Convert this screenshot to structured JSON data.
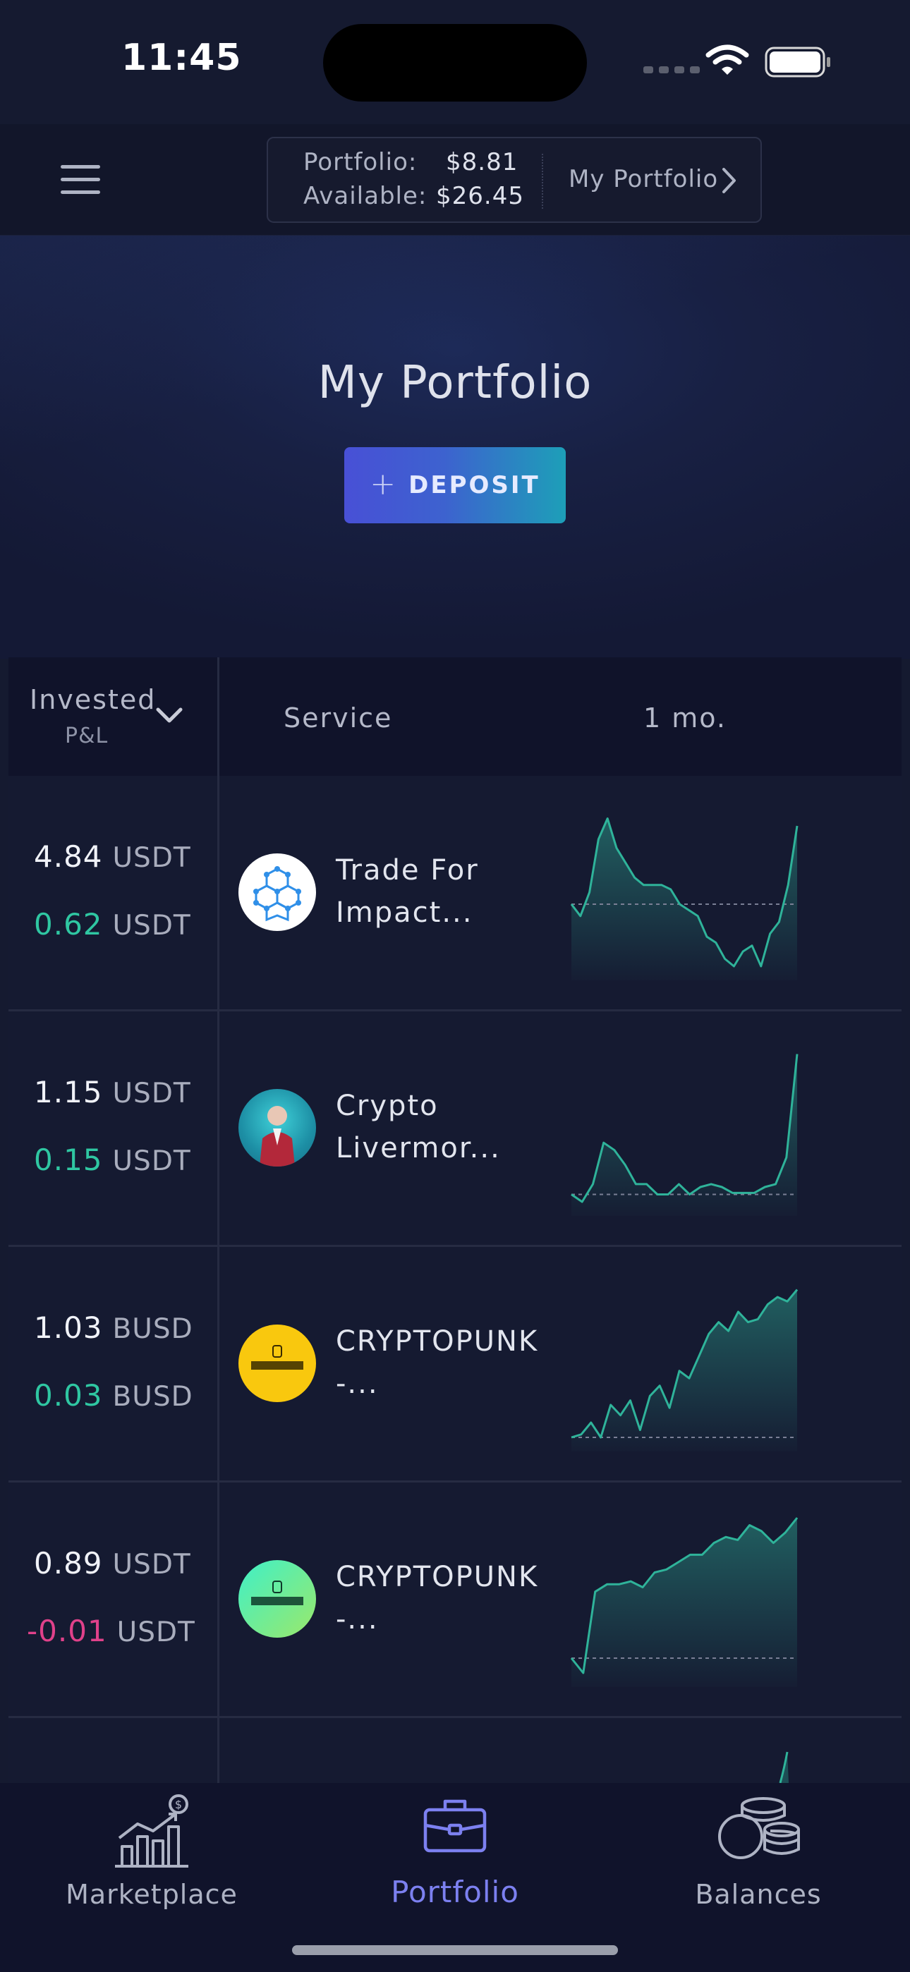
{
  "status_bar": {
    "time": "11:45",
    "icons": [
      "cellular-icon",
      "wifi-icon",
      "battery-icon"
    ]
  },
  "header": {
    "menu_icon": "menu-icon",
    "portfolio_label": "Portfolio:",
    "portfolio_value": "$8.81",
    "available_label": "Available:",
    "available_value": "$26.45",
    "link_label": "My Portfolio"
  },
  "hero": {
    "title": "My Portfolio",
    "deposit_icon": "+",
    "deposit_label": "DEPOSIT"
  },
  "table": {
    "col_invested": "Invested",
    "col_pnl": "P&L",
    "col_service": "Service",
    "col_period": "1 mo.",
    "rows": [
      {
        "invested": "4.84",
        "invested_cur": "USDT",
        "pnl": "0.62",
        "pnl_cur": "USDT",
        "pnl_sign": "positive",
        "service": "Trade For Impact...",
        "avatar": "cubes-logo-icon",
        "spark": [
          0.42,
          0.34,
          0.5,
          0.86,
          1.0,
          0.8,
          0.7,
          0.6,
          0.55,
          0.55,
          0.55,
          0.52,
          0.42,
          0.38,
          0.34,
          0.2,
          0.16,
          0.05,
          0.0,
          0.1,
          0.14,
          0.0,
          0.22,
          0.3,
          0.55,
          0.95
        ]
      },
      {
        "invested": "1.15",
        "invested_cur": "USDT",
        "pnl": "0.15",
        "pnl_cur": "USDT",
        "pnl_sign": "positive",
        "service": "Crypto Livermor...",
        "avatar": "person-avatar-icon",
        "spark": [
          0.05,
          0.0,
          0.12,
          0.4,
          0.35,
          0.25,
          0.12,
          0.12,
          0.05,
          0.05,
          0.12,
          0.05,
          0.1,
          0.12,
          0.1,
          0.06,
          0.06,
          0.06,
          0.1,
          0.12,
          0.3,
          1.0
        ]
      },
      {
        "invested": "1.03",
        "invested_cur": "BUSD",
        "pnl": "0.03",
        "pnl_cur": "BUSD",
        "pnl_sign": "positive",
        "service": "CRYPTOPUNK -...",
        "avatar": "cryptopunk-logo-yellow",
        "spark": [
          0.0,
          0.02,
          0.1,
          0.0,
          0.22,
          0.15,
          0.25,
          0.05,
          0.28,
          0.35,
          0.2,
          0.45,
          0.4,
          0.55,
          0.7,
          0.78,
          0.72,
          0.85,
          0.78,
          0.8,
          0.9,
          0.95,
          0.92,
          1.0
        ]
      },
      {
        "invested": "0.89",
        "invested_cur": "USDT",
        "pnl": "-0.01",
        "pnl_cur": "USDT",
        "pnl_sign": "negative",
        "service": "CRYPTOPUNK -...",
        "avatar": "cryptopunk-logo-green",
        "spark": [
          0.1,
          0.0,
          0.55,
          0.6,
          0.6,
          0.62,
          0.58,
          0.68,
          0.7,
          0.75,
          0.8,
          0.8,
          0.88,
          0.92,
          0.9,
          1.0,
          0.96,
          0.88,
          0.95,
          1.05
        ]
      }
    ]
  },
  "tab_bar": {
    "tabs": [
      {
        "label": "Marketplace",
        "icon": "chart-dollar-icon"
      },
      {
        "label": "Portfolio",
        "icon": "briefcase-icon"
      },
      {
        "label": "Balances",
        "icon": "coins-icon"
      }
    ],
    "active": "Portfolio"
  },
  "colors": {
    "accent": "#7c80f0",
    "positive": "#2fc7a2",
    "negative": "#e0418a",
    "spark_line": "#2fb39a"
  }
}
